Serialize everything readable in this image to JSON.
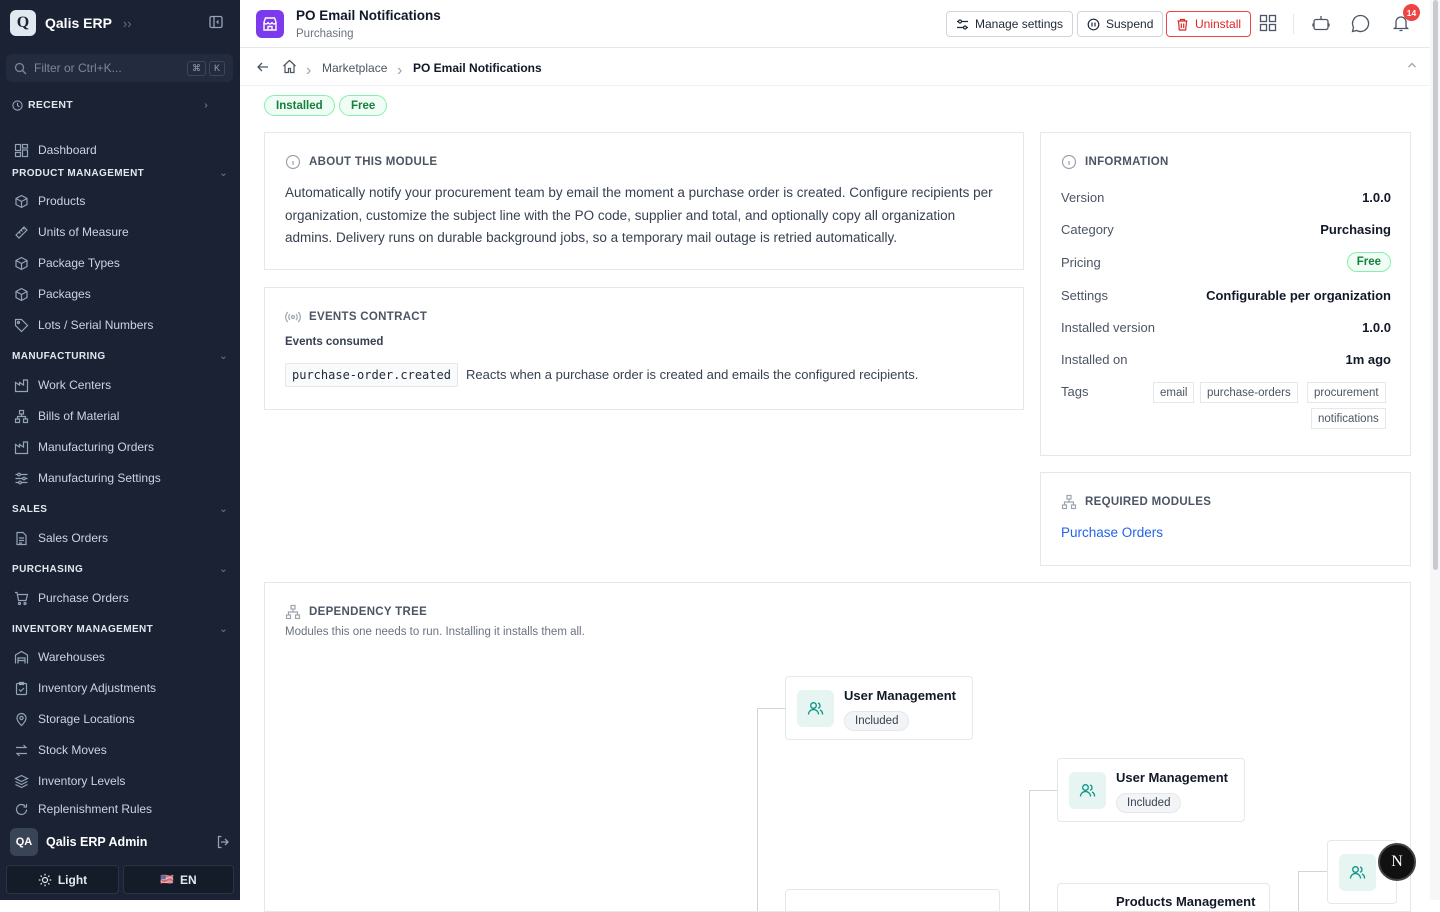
{
  "app": {
    "name": "Qalis ERP",
    "logo_letter": "Q"
  },
  "sidebar": {
    "filter_placeholder": "Filter or Ctrl+K...",
    "kbd": [
      "⌘",
      "K"
    ],
    "recent_label": "RECENT",
    "dashboard": "Dashboard",
    "sections": [
      {
        "title": "PRODUCT MANAGEMENT",
        "items": [
          "Products",
          "Units of Measure",
          "Package Types",
          "Packages",
          "Lots / Serial Numbers"
        ]
      },
      {
        "title": "MANUFACTURING",
        "items": [
          "Work Centers",
          "Bills of Material",
          "Manufacturing Orders",
          "Manufacturing Settings"
        ]
      },
      {
        "title": "SALES",
        "items": [
          "Sales Orders"
        ]
      },
      {
        "title": "PURCHASING",
        "items": [
          "Purchase Orders"
        ]
      },
      {
        "title": "INVENTORY MANAGEMENT",
        "items": [
          "Warehouses",
          "Inventory Adjustments",
          "Storage Locations",
          "Stock Moves",
          "Inventory Levels",
          "Replenishment Rules"
        ]
      }
    ],
    "user": {
      "initials": "QA",
      "name": "Qalis ERP Admin"
    },
    "theme_label": "Light",
    "lang_label": "EN",
    "lang_flag": "🇺🇸"
  },
  "header": {
    "title": "PO Email Notifications",
    "subtitle": "Purchasing",
    "manage_label": "Manage settings",
    "suspend_label": "Suspend",
    "uninstall_label": "Uninstall",
    "notification_count": "14"
  },
  "breadcrumb": {
    "marketplace": "Marketplace",
    "current": "PO Email Notifications"
  },
  "status": {
    "installed": "Installed",
    "free": "Free"
  },
  "about": {
    "title": "ABOUT THIS MODULE",
    "text": "Automatically notify your procurement team by email the moment a purchase order is created. Configure recipients per organization, customize the subject line with the PO code, supplier and total, and optionally copy all organization admins. Delivery runs on durable background jobs, so a temporary mail outage is retried automatically."
  },
  "events": {
    "title": "EVENTS CONTRACT",
    "consumed_label": "Events consumed",
    "event_code": "purchase-order.created",
    "event_desc": "Reacts when a purchase order is created and emails the configured recipients."
  },
  "info": {
    "title": "INFORMATION",
    "version_k": "Version",
    "version_v": "1.0.0",
    "category_k": "Category",
    "category_v": "Purchasing",
    "pricing_k": "Pricing",
    "pricing_v": "Free",
    "settings_k": "Settings",
    "settings_v": "Configurable per organization",
    "installed_version_k": "Installed version",
    "installed_version_v": "1.0.0",
    "installed_on_k": "Installed on",
    "installed_on_v": "1m ago",
    "tags_k": "Tags",
    "tags": [
      "email",
      "purchase-orders",
      "procurement",
      "notifications"
    ]
  },
  "required": {
    "title": "REQUIRED MODULES",
    "link": "Purchase Orders"
  },
  "dependency": {
    "title": "DEPENDENCY TREE",
    "subtitle": "Modules this one needs to run. Installing it installs them all.",
    "nodes": [
      {
        "name": "User Management",
        "status": "Included"
      },
      {
        "name": "User Management",
        "status": "Included"
      },
      {
        "name": "Products Management",
        "status": ""
      }
    ]
  },
  "floating": {
    "letter": "N"
  }
}
